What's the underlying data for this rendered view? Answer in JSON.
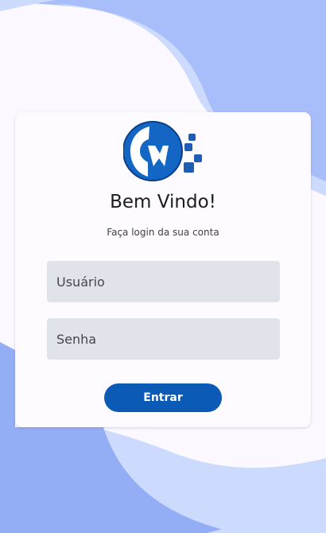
{
  "login": {
    "title": "Bem Vindo!",
    "subtitle": "Faça login da sua conta",
    "username_placeholder": "Usuário",
    "password_placeholder": "Senha",
    "submit_label": "Entrar"
  },
  "logo": {
    "icon": "m-logo-icon",
    "letter": "M"
  },
  "colors": {
    "page_background": "#fbf9ff",
    "wave_light": "#ccdafd",
    "wave_medium": "#a7befa",
    "wave_bottom": "#94aef6",
    "card_background": "#fdfbff",
    "field_background": "#e0e3e9",
    "button_background": "#0b5ab5",
    "logo_blue": "#1466c4"
  }
}
